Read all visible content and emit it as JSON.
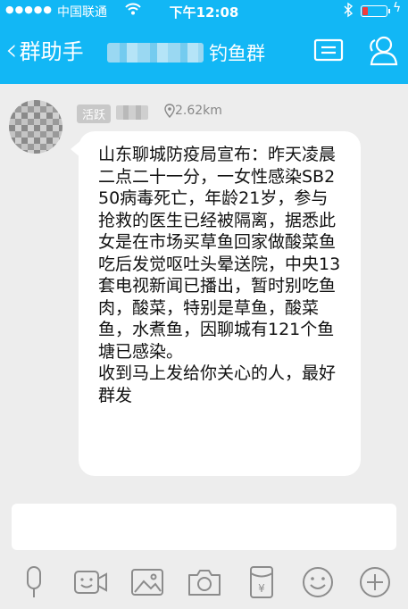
{
  "status_bar": {
    "signal": "●●●●●",
    "carrier": "中国联通",
    "time": "下午12:08"
  },
  "nav": {
    "back_label": "群助手",
    "group_name": "钓鱼群"
  },
  "message": {
    "badge": "活跃",
    "distance": "2.62km",
    "text": "山东聊城防疫局宣布：昨天凌晨二点二十一分，一女性感染SB250病毒死亡，年龄21岁，参与抢救的医生已经被隔离，据悉此女是在市场买草鱼回家做酸菜鱼吃后发觉呕吐头晕送院，中央13套电视新闻已播出，暂时别吃鱼肉，酸菜，特别是草鱼，酸菜鱼，水煮鱼，因聊城有121个鱼塘已感染。\n收到马上发给你关心的人，最好群发"
  },
  "colors": {
    "header": "#12b7f5",
    "background": "#ededed",
    "icon": "#8c8c8c"
  },
  "toolbar": {
    "icons": [
      "microphone-icon",
      "emoji-icon",
      "image-icon",
      "camera-icon",
      "red-packet-icon",
      "smile-icon",
      "plus-icon"
    ]
  }
}
